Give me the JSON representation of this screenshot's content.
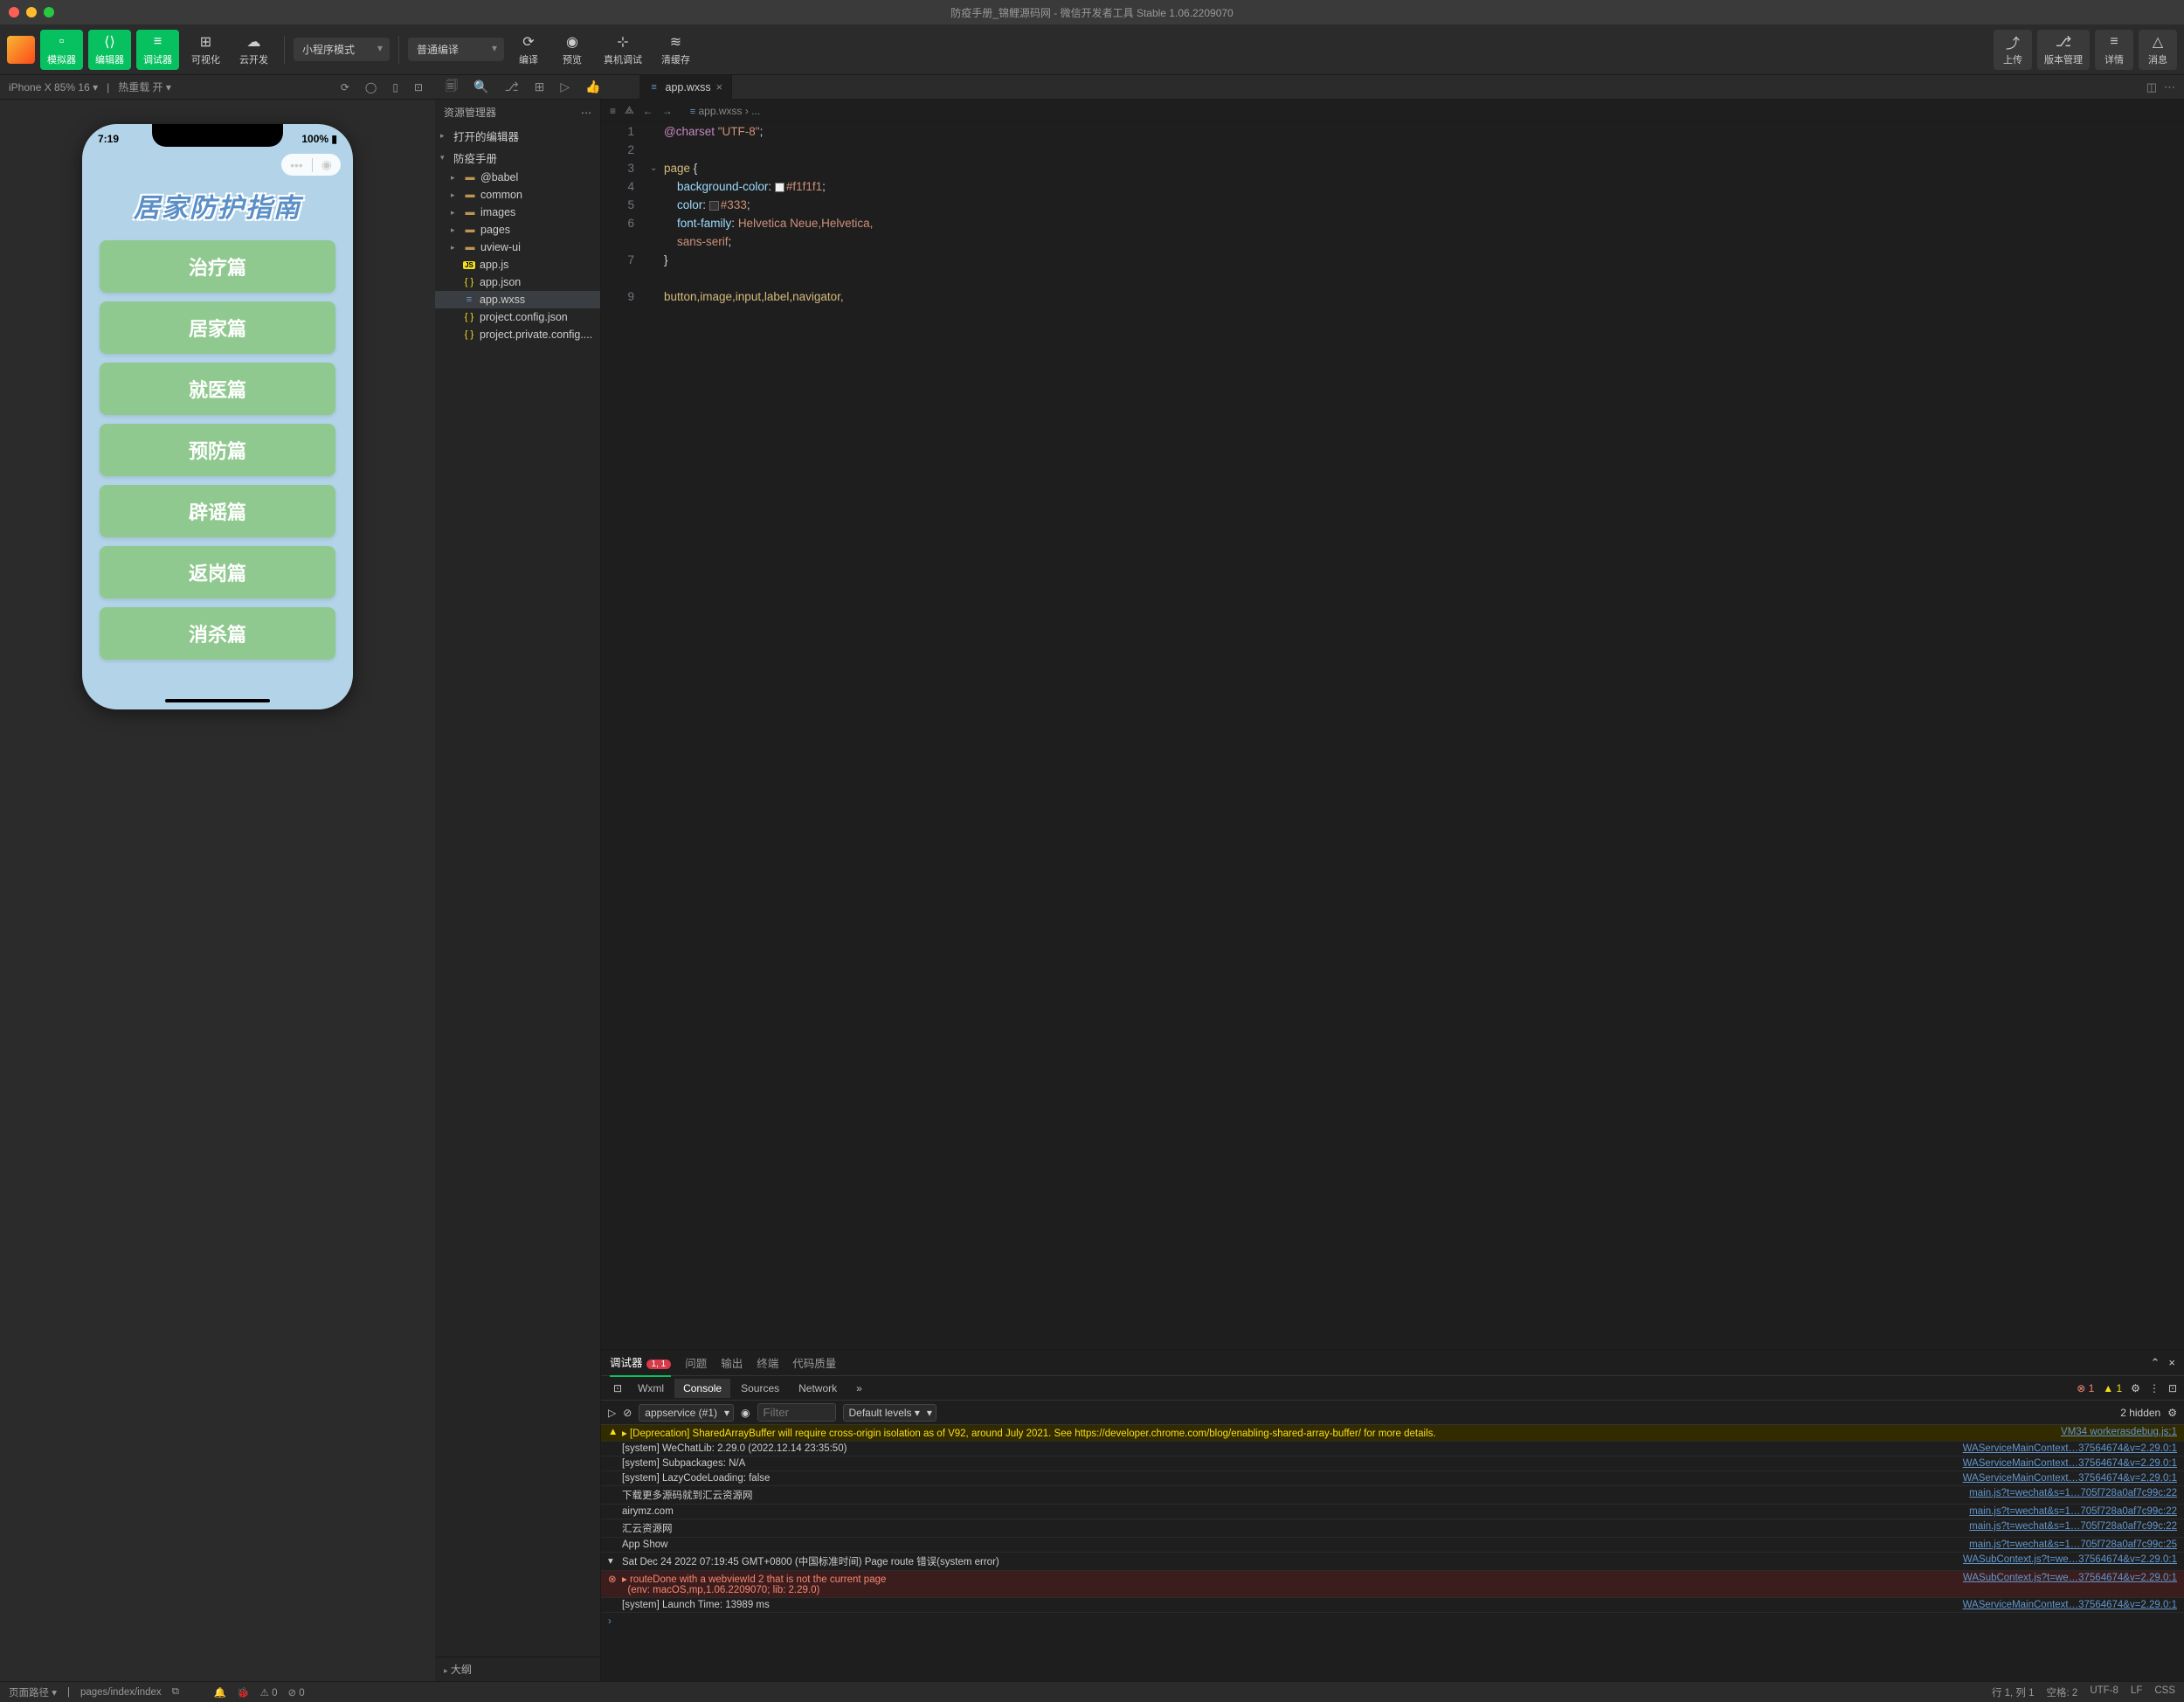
{
  "window": {
    "title": "防疫手册_锦鲤源码网 - 微信开发者工具 Stable 1.06.2209070"
  },
  "toolbar": {
    "simulator": "模拟器",
    "editor": "编辑器",
    "debugger": "调试器",
    "visualize": "可视化",
    "cloud": "云开发",
    "mode_select": "小程序模式",
    "compile_select": "普通编译",
    "compile": "编译",
    "preview": "预览",
    "remote_debug": "真机调试",
    "clear_cache": "清缓存",
    "upload": "上传",
    "version": "版本管理",
    "details": "详情",
    "notifications": "消息"
  },
  "sim_bar": {
    "device": "iPhone X 85% 16 ▾",
    "hot_reload": "热重载 开 ▾"
  },
  "simulator": {
    "time": "7:19",
    "battery": "100%",
    "app_title": "居家防护指南",
    "menu": [
      "治疗篇",
      "居家篇",
      "就医篇",
      "预防篇",
      "辟谣篇",
      "返岗篇",
      "消杀篇"
    ]
  },
  "explorer": {
    "title": "资源管理器",
    "open_editors": "打开的编辑器",
    "root": "防疫手册",
    "items": [
      {
        "name": "@babel",
        "type": "folder"
      },
      {
        "name": "common",
        "type": "folder"
      },
      {
        "name": "images",
        "type": "folder"
      },
      {
        "name": "pages",
        "type": "folder"
      },
      {
        "name": "uview-ui",
        "type": "folder"
      },
      {
        "name": "app.js",
        "type": "js"
      },
      {
        "name": "app.json",
        "type": "json"
      },
      {
        "name": "app.wxss",
        "type": "wxss",
        "active": true
      },
      {
        "name": "project.config.json",
        "type": "json"
      },
      {
        "name": "project.private.config....",
        "type": "json"
      }
    ],
    "outline": "大纲"
  },
  "editor": {
    "tab_name": "app.wxss",
    "breadcrumb": "app.wxss › ...",
    "code": {
      "l1_at": "@charset",
      "l1_str": " \"UTF-8\"",
      "l1_semi": ";",
      "l3_sel": "page",
      "l3_brace": " {",
      "l4_prop": "background-color",
      "l4_colon": ": ",
      "l4_val": "#f1f1f1",
      "l4_semi": ";",
      "l4_swatch": "#f1f1f1",
      "l5_prop": "color",
      "l5_colon": ": ",
      "l5_val": "#333",
      "l5_semi": ";",
      "l5_swatch": "#333333",
      "l6_prop": "font-family",
      "l6_colon": ": ",
      "l6_val": "Helvetica Neue,Helvetica,",
      "l6b_val": "sans-serif",
      "l6b_semi": ";",
      "l7_brace": "}",
      "l9_sel": "button,image,input,label,navigator,"
    }
  },
  "debugger": {
    "tab_debugger": "调试器",
    "tab_problems": "问题",
    "tab_output": "输出",
    "tab_terminal": "终端",
    "tab_quality": "代码质量",
    "badge_errors": "1, 1",
    "devtools": {
      "wxml": "Wxml",
      "console": "Console",
      "sources": "Sources",
      "network": "Network"
    },
    "context": "appservice (#1)",
    "filter_placeholder": "Filter",
    "levels": "Default levels ▾",
    "hidden": "2 hidden",
    "err_count": "1",
    "warn_count": "1",
    "console_rows": [
      {
        "type": "warn",
        "icon": "▲",
        "msg": "▸ [Deprecation] SharedArrayBuffer will require cross-origin isolation as of V92, around July 2021. See https://developer.chrome.com/blog/enabling-shared-array-buffer/ for more details.",
        "src": "VM34 workerasdebug.js:1"
      },
      {
        "type": "info",
        "icon": "",
        "msg": "[system] WeChatLib: 2.29.0 (2022.12.14 23:35:50)",
        "src": "WAServiceMainContext…37564674&v=2.29.0:1"
      },
      {
        "type": "info",
        "icon": "",
        "msg": "[system] Subpackages: N/A",
        "src": "WAServiceMainContext…37564674&v=2.29.0:1"
      },
      {
        "type": "info",
        "icon": "",
        "msg": "[system] LazyCodeLoading: false",
        "src": "WAServiceMainContext…37564674&v=2.29.0:1"
      },
      {
        "type": "info",
        "icon": "",
        "msg": "下载更多源码就到汇云资源网",
        "src": "main.js?t=wechat&s=1…705f728a0af7c99c:22"
      },
      {
        "type": "info",
        "icon": "",
        "msg": "airymz.com",
        "src": "main.js?t=wechat&s=1…705f728a0af7c99c:22"
      },
      {
        "type": "info",
        "icon": "",
        "msg": "汇云资源网",
        "src": "main.js?t=wechat&s=1…705f728a0af7c99c:22"
      },
      {
        "type": "info",
        "icon": "",
        "msg": "App Show",
        "src": "main.js?t=wechat&s=1…705f728a0af7c99c:25"
      },
      {
        "type": "info",
        "icon": "▾",
        "msg": "Sat Dec 24 2022 07:19:45 GMT+0800 (中国标准时间) Page route 错误(system error)",
        "src": "WASubContext.js?t=we…37564674&v=2.29.0:1"
      },
      {
        "type": "err",
        "icon": "⊗",
        "msg": "▸ routeDone with a webviewId 2 that is not the current page\n  (env: macOS,mp,1.06.2209070; lib: 2.29.0)",
        "src": "WASubContext.js?t=we…37564674&v=2.29.0:1"
      },
      {
        "type": "info",
        "icon": "",
        "msg": "[system] Launch Time: 13989 ms",
        "src": "WAServiceMainContext…37564674&v=2.29.0:1"
      }
    ]
  },
  "status": {
    "page_path_label": "页面路径 ▾",
    "page_path": "pages/index/index",
    "warnings": "⚠ 0",
    "errors": "⊘ 0",
    "cursor": "行 1, 列 1",
    "spaces": "空格: 2",
    "encoding": "UTF-8",
    "eol": "LF",
    "lang": "CSS"
  }
}
